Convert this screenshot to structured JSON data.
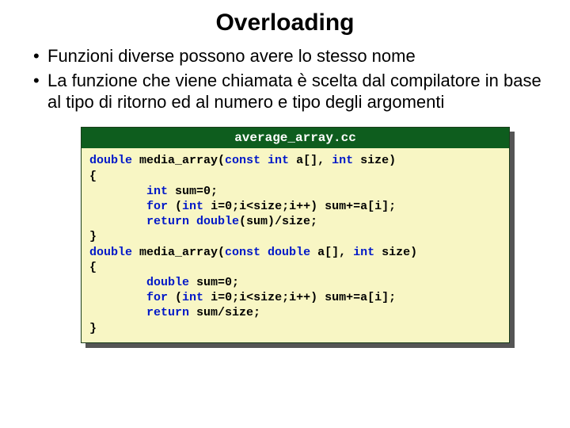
{
  "title": "Overloading",
  "bullets": [
    "Funzioni diverse possono avere lo stesso nome",
    "La funzione che viene chiamata è scelta dal compilatore in base al tipo di ritorno ed al numero e tipo degli argomenti"
  ],
  "code": {
    "filename": "average_array.cc",
    "l1a": "double",
    "l1b": " media_array(",
    "l1c": "const int",
    "l1d": " a[], ",
    "l1e": "int",
    "l1f": " size)",
    "l2": "{",
    "l3a": "        ",
    "l3b": "int",
    "l3c": " sum=0;",
    "l4a": "        ",
    "l4b": "for",
    "l4c": " (",
    "l4d": "int",
    "l4e": " i=0;i<size;i++) sum+=a[i];",
    "l5a": "        ",
    "l5b": "return double",
    "l5c": "(sum)/size;",
    "l6": "}",
    "l7a": "double",
    "l7b": " media_array(",
    "l7c": "const double",
    "l7d": " a[], ",
    "l7e": "int",
    "l7f": " size)",
    "l8": "{",
    "l9a": "        ",
    "l9b": "double",
    "l9c": " sum=0;",
    "l10a": "        ",
    "l10b": "for",
    "l10c": " (",
    "l10d": "int",
    "l10e": " i=0;i<size;i++) sum+=a[i];",
    "l11a": "        ",
    "l11b": "return",
    "l11c": " sum/size;",
    "l12": "}"
  }
}
